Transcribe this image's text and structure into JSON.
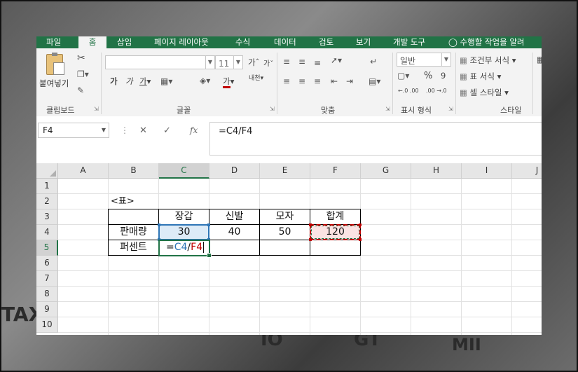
{
  "ribbon_tabs": [
    "파일",
    "홈",
    "삽입",
    "페이지 레이아웃",
    "수식",
    "데이터",
    "검토",
    "보기",
    "개발 도구",
    "수행할 작업을 알려"
  ],
  "tell_me_icon": "lightbulb-icon",
  "clipboard": {
    "paste_label": "붙여넣기",
    "group_label": "클립보드"
  },
  "font": {
    "name_value": "",
    "size_value": "11",
    "bold": "가",
    "italic": "가",
    "underline": "가",
    "grow": "가",
    "shrink": "가",
    "color_glyph": "가",
    "phonetic": "내천",
    "group_label": "글꼴"
  },
  "alignment": {
    "group_label": "맞춤"
  },
  "number": {
    "format_value": "일반",
    "percent": "%",
    "comma": "9",
    "inc_decimal": "←.0 .00",
    "dec_decimal": ".00 →.0",
    "group_label": "표시 형식"
  },
  "styles": {
    "conditional": "조건부 서식",
    "as_table": "표 서식",
    "cell_styles": "셀 스타일",
    "group_label": "스타일"
  },
  "formula_bar": {
    "name_box": "F4",
    "fx": "fx",
    "formula": "=C4/F4"
  },
  "columns": [
    "A",
    "B",
    "C",
    "D",
    "E",
    "F",
    "G",
    "H",
    "I",
    "J"
  ],
  "rows": [
    "1",
    "2",
    "3",
    "4",
    "5",
    "6",
    "7",
    "8",
    "9",
    "10"
  ],
  "sheet": {
    "b2": "<표>",
    "headers": [
      "장갑",
      "신발",
      "모자",
      "합계"
    ],
    "row4_label": "판매량",
    "row4_values": [
      "30",
      "40",
      "50",
      "120"
    ],
    "row5_label": "퍼센트",
    "edit_prefix": "=",
    "edit_ref1": "C4",
    "edit_slash": "/",
    "edit_ref2": "F4"
  },
  "colors": {
    "excel_green": "#217346",
    "ref_blue": "#2e75b6",
    "ref_red": "#c00000"
  },
  "background_decor": [
    "TAX",
    "IO",
    "GT",
    "MII"
  ]
}
